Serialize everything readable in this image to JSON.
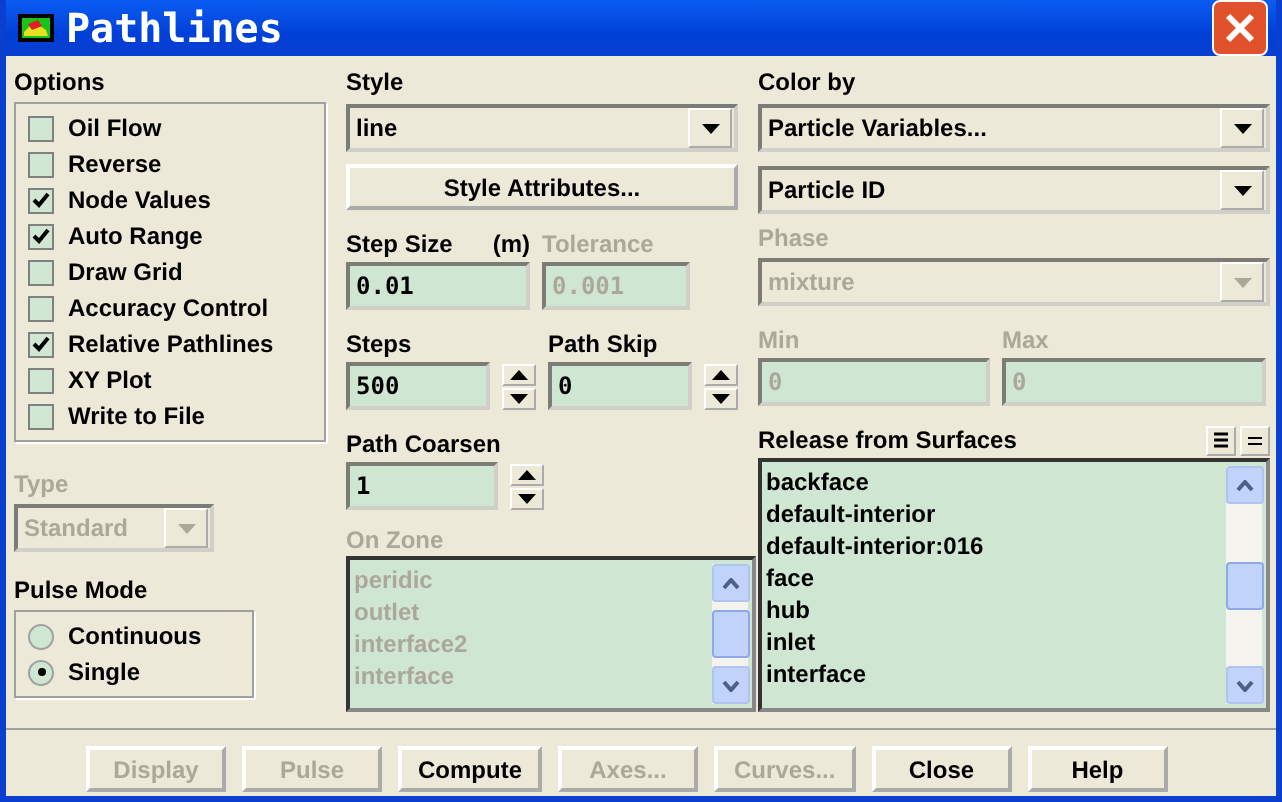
{
  "window": {
    "title": "Pathlines"
  },
  "options": {
    "label": "Options",
    "items": [
      {
        "label": "Oil Flow",
        "checked": false
      },
      {
        "label": "Reverse",
        "checked": false
      },
      {
        "label": "Node Values",
        "checked": true
      },
      {
        "label": "Auto Range",
        "checked": true
      },
      {
        "label": "Draw Grid",
        "checked": false
      },
      {
        "label": "Accuracy Control",
        "checked": false
      },
      {
        "label": "Relative Pathlines",
        "checked": true
      },
      {
        "label": "XY Plot",
        "checked": false
      },
      {
        "label": "Write to File",
        "checked": false
      }
    ]
  },
  "type": {
    "label": "Type",
    "value": "Standard",
    "disabled": true
  },
  "pulse_mode": {
    "label": "Pulse Mode",
    "items": [
      {
        "label": "Continuous",
        "selected": false
      },
      {
        "label": "Single",
        "selected": true
      }
    ]
  },
  "style": {
    "label": "Style",
    "value": "line",
    "button": "Style Attributes..."
  },
  "step_size": {
    "label": "Step Size",
    "unit": "(m)",
    "value": "0.01"
  },
  "tolerance": {
    "label": "Tolerance",
    "value": "0.001",
    "disabled": true
  },
  "steps": {
    "label": "Steps",
    "value": "500"
  },
  "path_skip": {
    "label": "Path Skip",
    "value": "0"
  },
  "path_coarsen": {
    "label": "Path Coarsen",
    "value": "1"
  },
  "on_zone": {
    "label": "On Zone",
    "disabled": true,
    "items": [
      "peridic",
      "outlet",
      "interface2",
      "interface"
    ]
  },
  "color_by": {
    "label": "Color by",
    "value": "Particle Variables...",
    "sub_value": "Particle ID"
  },
  "phase": {
    "label": "Phase",
    "value": "mixture",
    "disabled": true
  },
  "min": {
    "label": "Min",
    "value": "0",
    "disabled": true
  },
  "max": {
    "label": "Max",
    "value": "0",
    "disabled": true
  },
  "release": {
    "label": "Release from Surfaces",
    "items": [
      "backface",
      "default-interior",
      "default-interior:016",
      "face",
      "hub",
      "inlet",
      "interface"
    ]
  },
  "buttons": [
    {
      "label": "Display",
      "disabled": true
    },
    {
      "label": "Pulse",
      "disabled": true
    },
    {
      "label": "Compute",
      "disabled": false
    },
    {
      "label": "Axes...",
      "disabled": true
    },
    {
      "label": "Curves...",
      "disabled": true
    },
    {
      "label": "Close",
      "disabled": false
    },
    {
      "label": "Help",
      "disabled": false
    }
  ]
}
